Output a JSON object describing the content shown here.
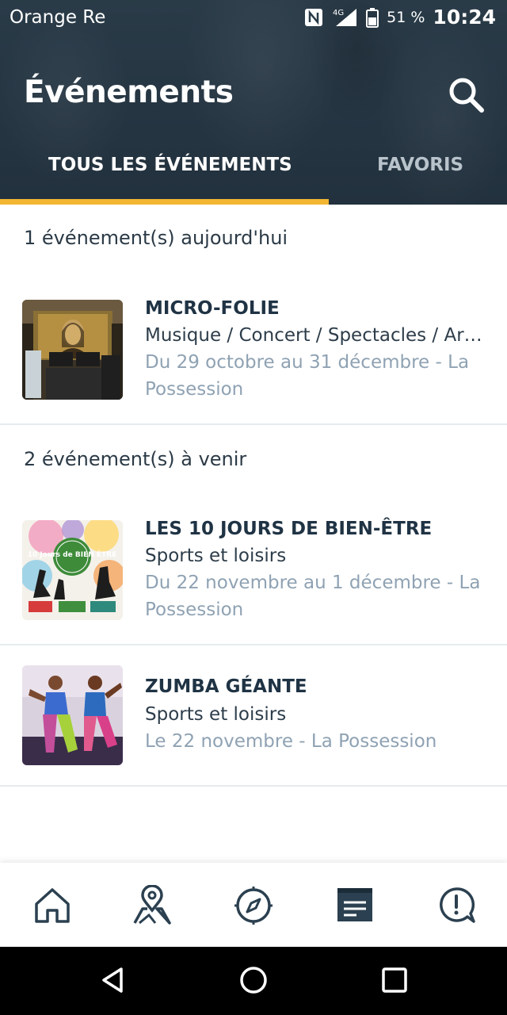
{
  "status_bar": {
    "carrier": "Orange Re",
    "network": "4G",
    "battery": "51 %",
    "time": "10:24"
  },
  "header": {
    "title": "Événements",
    "search_icon": "search-icon"
  },
  "tabs": [
    {
      "label": "TOUS LES ÉVÉNEMENTS",
      "active": true
    },
    {
      "label": "FAVORIS",
      "active": false
    }
  ],
  "sections": [
    {
      "header": "1 événement(s) aujourd'hui",
      "events": [
        {
          "title": "MICRO-FOLIE",
          "category": "Musique / Concert / Spectacles / Ar…",
          "date": "Du 29 octobre au 31 décembre - La Possession"
        }
      ]
    },
    {
      "header": "2 événement(s) à venir",
      "events": [
        {
          "title": "LES 10 JOURS DE BIEN-ÊTRE",
          "category": "Sports et loisirs",
          "date": "Du 22 novembre au 1 décembre - La Possession",
          "poster_text": "10 Jours de BIEN ÊTRE"
        },
        {
          "title": "ZUMBA GÉANTE",
          "category": "Sports et loisirs",
          "date": "Le 22 novembre - La Possession"
        }
      ]
    }
  ],
  "bottom_nav": [
    {
      "icon": "home-icon"
    },
    {
      "icon": "map-pin-icon"
    },
    {
      "icon": "compass-icon"
    },
    {
      "icon": "calendar-icon",
      "active": true
    },
    {
      "icon": "help-chat-icon"
    }
  ],
  "colors": {
    "header_bg": "#253542",
    "accent": "#f2b632",
    "title_text": "#1f3344",
    "date_text": "#8fa2b3",
    "icon": "#2b4050"
  }
}
